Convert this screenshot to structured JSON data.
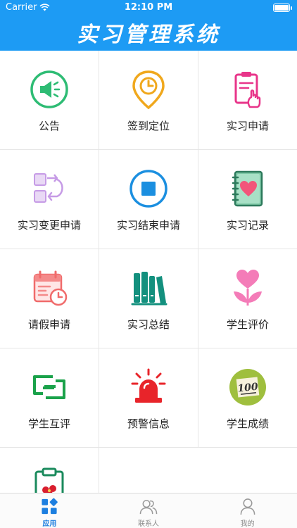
{
  "status_bar": {
    "carrier": "Carrier",
    "time": "12:10 PM"
  },
  "header": {
    "title": "实习管理系统"
  },
  "grid": [
    {
      "label": "公告",
      "icon": "megaphone-icon"
    },
    {
      "label": "签到定位",
      "icon": "location-pin-icon"
    },
    {
      "label": "实习申请",
      "icon": "application-form-icon"
    },
    {
      "label": "实习变更申请",
      "icon": "swap-icon"
    },
    {
      "label": "实习结束申请",
      "icon": "stop-icon"
    },
    {
      "label": "实习记录",
      "icon": "notebook-icon"
    },
    {
      "label": "请假申请",
      "icon": "calendar-clock-icon"
    },
    {
      "label": "实习总结",
      "icon": "books-icon"
    },
    {
      "label": "学生评价",
      "icon": "flower-icon"
    },
    {
      "label": "学生互评",
      "icon": "interlock-icon"
    },
    {
      "label": "预警信息",
      "icon": "siren-icon"
    },
    {
      "label": "学生成绩",
      "icon": "score-icon"
    },
    {
      "label": "",
      "icon": "clipboard-icon"
    }
  ],
  "tabs": [
    {
      "label": "应用",
      "icon": "apps-icon",
      "active": true
    },
    {
      "label": "联系人",
      "icon": "contacts-icon",
      "active": false
    },
    {
      "label": "我的",
      "icon": "profile-icon",
      "active": false
    }
  ],
  "colors": {
    "header": "#1d9bf4",
    "tab_active": "#1d7fe0"
  }
}
